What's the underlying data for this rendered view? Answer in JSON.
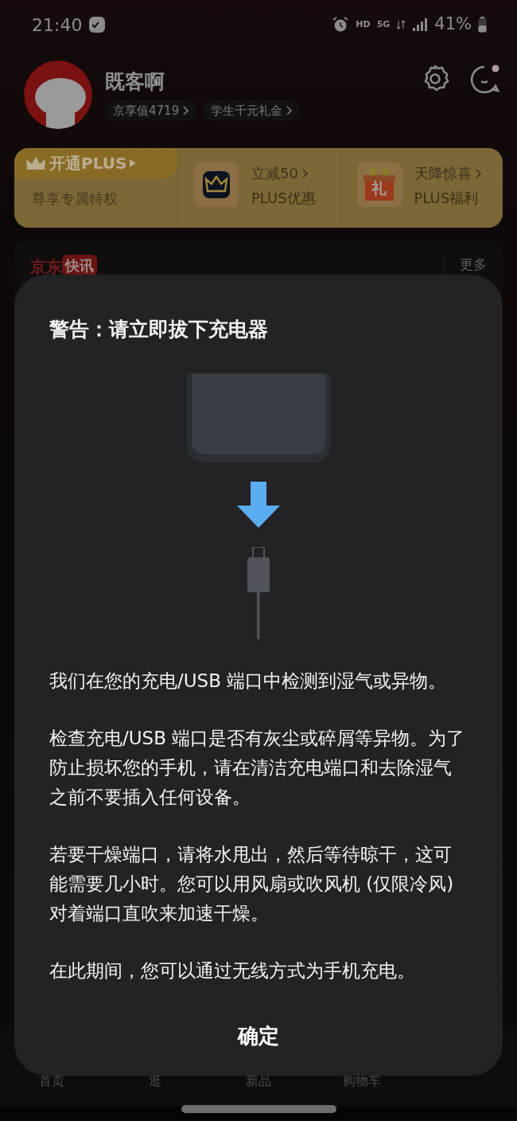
{
  "status_bar": {
    "time": "21:40",
    "indicators": [
      "HD",
      "5G"
    ],
    "battery": "41%"
  },
  "profile": {
    "name": "既客啊",
    "chips": [
      "京享值4719",
      "学生千元礼金"
    ]
  },
  "plus_card": {
    "open_label": "开通PLUS",
    "subtitle": "尊享专属特权",
    "offers": [
      {
        "kind": "crown",
        "title": "立减50",
        "subtitle": "PLUS优惠"
      },
      {
        "kind": "gift",
        "icon_text": "礼",
        "title": "天降惊喜",
        "subtitle": "PLUS福利"
      }
    ]
  },
  "news": {
    "brand": "京东",
    "tag": "快讯",
    "more": "更多"
  },
  "dialog": {
    "title": "警告：请立即拔下充电器",
    "paragraphs": [
      "我们在您的充电/USB 端口中检测到湿气或异物。",
      "检查充电/USB 端口是否有灰尘或碎屑等异物。为了防止损坏您的手机，请在清洁充电端口和去除湿气之前不要插入任何设备。",
      "若要干燥端口，请将水甩出，然后等待晾干，这可能需要几小时。您可以用风扇或吹风机 (仅限冷风) 对着端口直吹来加速干燥。",
      "在此期间，您可以通过无线方式为手机充电。"
    ],
    "button": "确定"
  },
  "bottom_nav": [
    {
      "label": "首页"
    },
    {
      "label": "逛"
    },
    {
      "label": "新品"
    },
    {
      "label": "购物车"
    }
  ]
}
